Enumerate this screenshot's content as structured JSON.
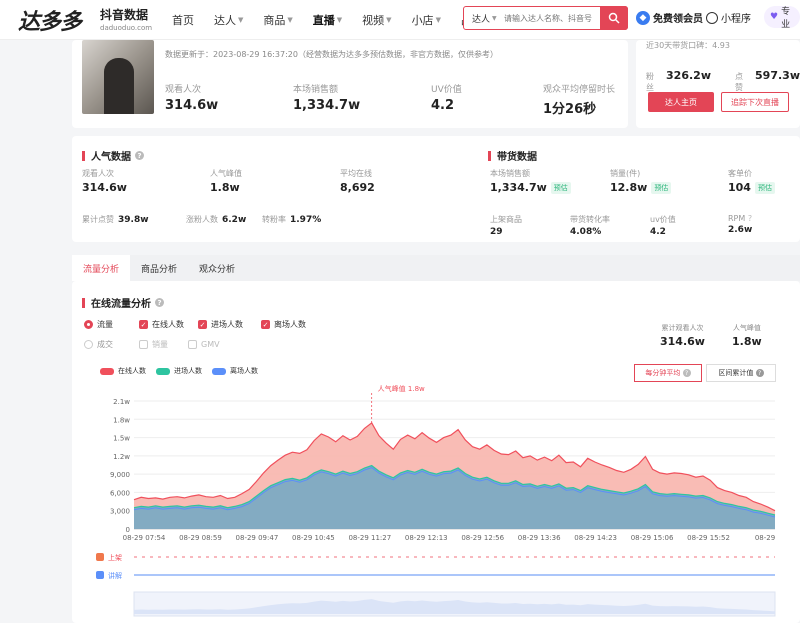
{
  "header": {
    "logo_text": "达多多",
    "logo_sub": "抖音数据",
    "logo_url": "daduoduo.com",
    "nav": [
      {
        "label": "首页",
        "dropdown": false,
        "active": false
      },
      {
        "label": "达人",
        "dropdown": true,
        "active": false
      },
      {
        "label": "商品",
        "dropdown": true,
        "active": false
      },
      {
        "label": "直播",
        "dropdown": true,
        "active": true
      },
      {
        "label": "视频",
        "dropdown": true,
        "active": false
      },
      {
        "label": "小店",
        "dropdown": true,
        "active": false
      },
      {
        "label": "品牌",
        "dropdown": true,
        "active": false
      }
    ],
    "search_category": "达人",
    "search_placeholder": "请输入达人名称、抖音号",
    "vip_label": "免费领会员",
    "mini_program": "小程序",
    "pro_label": "专业"
  },
  "live": {
    "update_text": "数据更新于：2023-08-29 16:37:20（经营数据为达多多预估数据，非官方数据，仅供参考）",
    "metrics": [
      {
        "label": "观看人次",
        "value": "314.6w"
      },
      {
        "label": "本场销售额",
        "value": "1,334.7w"
      },
      {
        "label": "UV价值",
        "value": "4.2"
      },
      {
        "label": "观众平均停留时长",
        "value": "1分26秒"
      }
    ]
  },
  "side": {
    "top_text": "近30天带货口碑：4.93",
    "fans_label": "粉丝",
    "fans": "326.2w",
    "likes_label": "点赞",
    "likes": "597.3w",
    "primary_btn": "达人主页",
    "secondary_btn": "追踪下次直播"
  },
  "popularity": {
    "title": "人气数据",
    "stats": [
      {
        "label": "观看人次",
        "value": "314.6w"
      },
      {
        "label": "人气峰值",
        "value": "1.8w"
      },
      {
        "label": "平均在线",
        "value": "8,692"
      }
    ],
    "inline": [
      {
        "label": "累计点赞",
        "value": "39.8w"
      },
      {
        "label": "涨粉人数",
        "value": "6.2w"
      },
      {
        "label": "转粉率",
        "value": "1.97%"
      }
    ]
  },
  "sales": {
    "title": "带货数据",
    "tag": "预估",
    "stats": [
      {
        "label": "本场销售额",
        "value": "1,334.7w",
        "tag": true
      },
      {
        "label": "销量(件)",
        "value": "12.8w",
        "tag": true
      },
      {
        "label": "客单价",
        "value": "104",
        "tag": true
      }
    ],
    "stats2": [
      {
        "label": "上架商品",
        "value": "29"
      },
      {
        "label": "带货转化率",
        "value": "4.08%"
      },
      {
        "label": "uv价值",
        "value": "4.2"
      },
      {
        "label": "RPM",
        "value": "2.6w"
      }
    ]
  },
  "tabs": [
    "流量分析",
    "商品分析",
    "观众分析"
  ],
  "flow": {
    "title": "在线流量分析",
    "row1": {
      "radio": "流量",
      "checks": [
        "在线人数",
        "进场人数",
        "离场人数"
      ]
    },
    "row2": {
      "radio": "成交",
      "checks": [
        "销量",
        "GMV"
      ]
    },
    "right_metrics": [
      {
        "label": "累计观看人次",
        "value": "314.6w"
      },
      {
        "label": "人气峰值",
        "value": "1.8w"
      }
    ],
    "mode_buttons": [
      "每分钟平均",
      "区间累计值"
    ]
  },
  "chart_data": {
    "type": "area",
    "series": [
      {
        "name": "在线人数",
        "color": "#f0505c"
      },
      {
        "name": "进场人数",
        "color": "#2ec4a0"
      },
      {
        "name": "离场人数",
        "color": "#5b8ff9"
      }
    ],
    "peak_label": "人气峰值 1.8w",
    "y_ticks": [
      "0",
      "3,000",
      "6,000",
      "9,000",
      "1.2w",
      "1.5w",
      "1.8w",
      "2.1w"
    ],
    "ylim": [
      0,
      21000
    ],
    "x_ticks": [
      "08-29 07:54",
      "08-29 08:59",
      "08-29 09:47",
      "08-29 10:45",
      "08-29 11:27",
      "08-29 12:13",
      "08-29 12:56",
      "08-29 13:36",
      "08-29 14:23",
      "08-29 15:06",
      "08-29 15:52",
      "08-29"
    ],
    "online": [
      4800,
      5200,
      5000,
      5100,
      4900,
      5200,
      5300,
      5100,
      5400,
      5600,
      5300,
      5200,
      5500,
      5000,
      5200,
      5800,
      6500,
      7800,
      9200,
      10400,
      11300,
      12100,
      12600,
      12400,
      13000,
      14500,
      15600,
      15100,
      14300,
      15300,
      14600,
      15200,
      16500,
      17400,
      15300,
      14100,
      13100,
      14700,
      15400,
      14800,
      15800,
      14900,
      14200,
      15000,
      15400,
      16300,
      14600,
      13500,
      13100,
      13800,
      12900,
      12300,
      12200,
      12800,
      11700,
      12000,
      11300,
      11800,
      11200,
      12100,
      10900,
      11000,
      10200,
      11600,
      11000,
      10500,
      10100,
      9600,
      9300,
      9800,
      10600,
      11900,
      9800,
      9200,
      9000,
      9200,
      9100,
      8900,
      8500,
      8700,
      8000,
      6800,
      6300,
      6000,
      5500,
      5200,
      4500,
      4100,
      3600,
      3000
    ],
    "entry": [
      3500,
      3700,
      3600,
      3800,
      3600,
      3700,
      3800,
      3600,
      3800,
      3900,
      3700,
      3600,
      3800,
      3500,
      3700,
      4000,
      4500,
      5400,
      6300,
      7100,
      7600,
      8100,
      8300,
      8000,
      8400,
      9200,
      9700,
      9400,
      9000,
      9500,
      9100,
      9400,
      10000,
      10400,
      9500,
      8900,
      8400,
      9200,
      9600,
      9300,
      9800,
      9300,
      9000,
      9400,
      9500,
      10000,
      9100,
      8500,
      8200,
      8500,
      7900,
      7500,
      7500,
      7900,
      7300,
      7400,
      7000,
      7300,
      7000,
      7400,
      6700,
      6800,
      6300,
      7100,
      6800,
      6500,
      6300,
      6100,
      5900,
      6200,
      6600,
      7300,
      6100,
      5800,
      5700,
      5800,
      5700,
      5600,
      5400,
      5500,
      5100,
      4500,
      4200,
      4000,
      3700,
      3500,
      3100,
      2900,
      2600,
      2300
    ]
  },
  "timeline": {
    "up_label": "上架",
    "explain_label": "讲解"
  }
}
